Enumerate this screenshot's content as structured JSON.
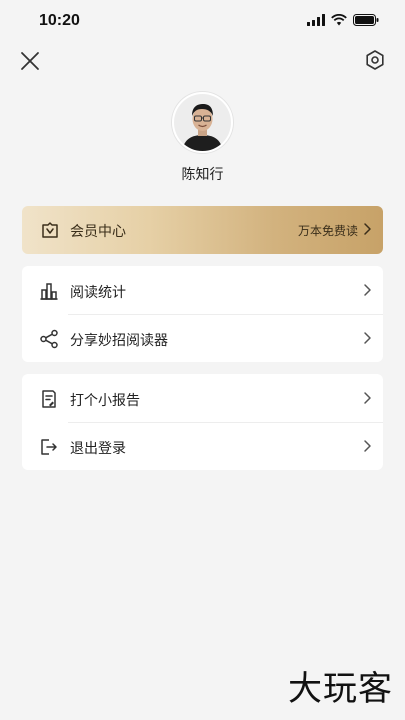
{
  "status_bar": {
    "time": "10:20"
  },
  "profile": {
    "name": "陈知行"
  },
  "member": {
    "label": "会员中心",
    "promo": "万本免费读"
  },
  "menu_group_1": [
    {
      "label": "阅读统计",
      "icon": "bar-chart-icon"
    },
    {
      "label": "分享妙招阅读器",
      "icon": "share-icon"
    }
  ],
  "menu_group_2": [
    {
      "label": "打个小报告",
      "icon": "report-icon"
    },
    {
      "label": "退出登录",
      "icon": "logout-icon"
    }
  ],
  "watermark": "大玩客",
  "colors": {
    "background": "#f4f4f4",
    "gold_start": "#f0e3c9",
    "gold_end": "#c7a268"
  }
}
